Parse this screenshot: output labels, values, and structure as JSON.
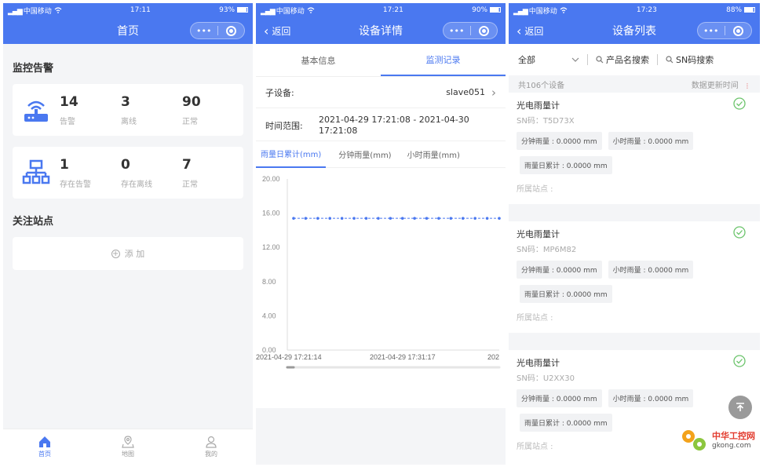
{
  "colors": {
    "primary": "#4a78f0",
    "success": "#6cc46c",
    "muted": "#aaaaaa"
  },
  "icons": [
    "wifi-icon",
    "battery-icon",
    "router-icon",
    "network-icon",
    "add-icon",
    "home-icon",
    "map-icon",
    "user-icon",
    "search-icon",
    "check-circle-icon",
    "chevron-right-icon",
    "chevron-down-icon",
    "sort-icon",
    "arrow-up-icon"
  ],
  "screen1": {
    "status": {
      "carrier": "中国移动",
      "time": "17:11",
      "battery": "93%"
    },
    "title": "首页",
    "capsule_dots": "•••",
    "monitor_title": "监控告警",
    "alarm_card": [
      {
        "num": "14",
        "label": "告警"
      },
      {
        "num": "3",
        "label": "离线"
      },
      {
        "num": "90",
        "label": "正常"
      }
    ],
    "site_card": [
      {
        "num": "1",
        "label": "存在告警"
      },
      {
        "num": "0",
        "label": "存在离线"
      },
      {
        "num": "7",
        "label": "正常"
      }
    ],
    "follow_title": "关注站点",
    "add_label": "添 加",
    "tabbar": [
      {
        "label": "首页"
      },
      {
        "label": "地图"
      },
      {
        "label": "我的"
      }
    ]
  },
  "screen2": {
    "status": {
      "carrier": "中国移动",
      "time": "17:21",
      "battery": "90%"
    },
    "back": "返回",
    "title": "设备详情",
    "capsule_dots": "•••",
    "tabs": [
      "基本信息",
      "监测记录"
    ],
    "subdevice_label": "子设备:",
    "subdevice_value": "slave051",
    "range_label": "时间范围:",
    "range_value": "2021-04-29 17:21:08 - 2021-04-30 17:21:08",
    "subtabs": [
      "雨量日累计(mm)",
      "分钟雨量(mm)",
      "小时雨量(mm)"
    ]
  },
  "chart_data": {
    "type": "line",
    "title": "",
    "xlabel": "",
    "ylabel": "",
    "ylim": [
      0,
      20
    ],
    "yticks": [
      "0.00",
      "4.00",
      "8.00",
      "12.00",
      "16.00",
      "20.00"
    ],
    "xticks": [
      "2021-04-29 17:21:14",
      "2021-04-29 17:31:17",
      "202"
    ],
    "grid": false,
    "series": [
      {
        "values": [
          15.4,
          15.4,
          15.4,
          15.4,
          15.4,
          15.4,
          15.4,
          15.4,
          15.4,
          15.4,
          15.4,
          15.4,
          15.4,
          15.4,
          15.4,
          15.4,
          15.4,
          15.4
        ]
      }
    ]
  },
  "screen3": {
    "status": {
      "carrier": "中国移动",
      "time": "17:23",
      "battery": "88%"
    },
    "back": "返回",
    "title": "设备列表",
    "capsule_dots": "•••",
    "filter_all": "全部",
    "search_product": "产品名搜索",
    "search_sn": "SN码搜索",
    "count": "共106个设备",
    "sort_label": "数据更新时间",
    "devices": [
      {
        "name": "光电雨量计",
        "sn": "SN码：T5D73X",
        "minute": "分钟雨量 : 0.0000 mm",
        "hour": "小时雨量 : 0.0000 mm",
        "day": "雨量日累计 : 0.0000 mm",
        "site": "所属站点 :"
      },
      {
        "name": "光电雨量计",
        "sn": "SN码：MP6M82",
        "minute": "分钟雨量 : 0.0000 mm",
        "hour": "小时雨量 : 0.0000 mm",
        "day": "雨量日累计 : 0.0000 mm",
        "site": "所属站点 :"
      },
      {
        "name": "光电雨量计",
        "sn": "SN码：U2XX30",
        "minute": "分钟雨量 : 0.0000 mm",
        "hour": "小时雨量 : 0.0000 mm",
        "day": "雨量日累计 : 0.0000 mm",
        "site": "所属站点 :"
      }
    ],
    "watermark": {
      "cn": "中华工控网",
      "domain": "gkong.com"
    }
  }
}
